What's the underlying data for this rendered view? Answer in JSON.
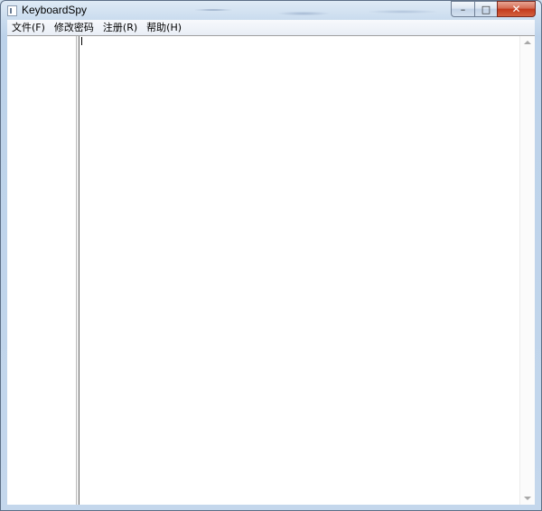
{
  "window": {
    "title": "KeyboardSpy",
    "app_icon": "document-icon",
    "caption": {
      "minimize_glyph": "–",
      "maximize_glyph": "□",
      "close_glyph": "✕"
    }
  },
  "menubar": {
    "items": [
      {
        "label": "文件(F)"
      },
      {
        "label": "修改密码"
      },
      {
        "label": "注册(R)"
      },
      {
        "label": "帮助(H)"
      }
    ]
  },
  "colors": {
    "close_button": "#c2391b",
    "frame": "#bcd2ea",
    "client_background": "#ffffff"
  }
}
